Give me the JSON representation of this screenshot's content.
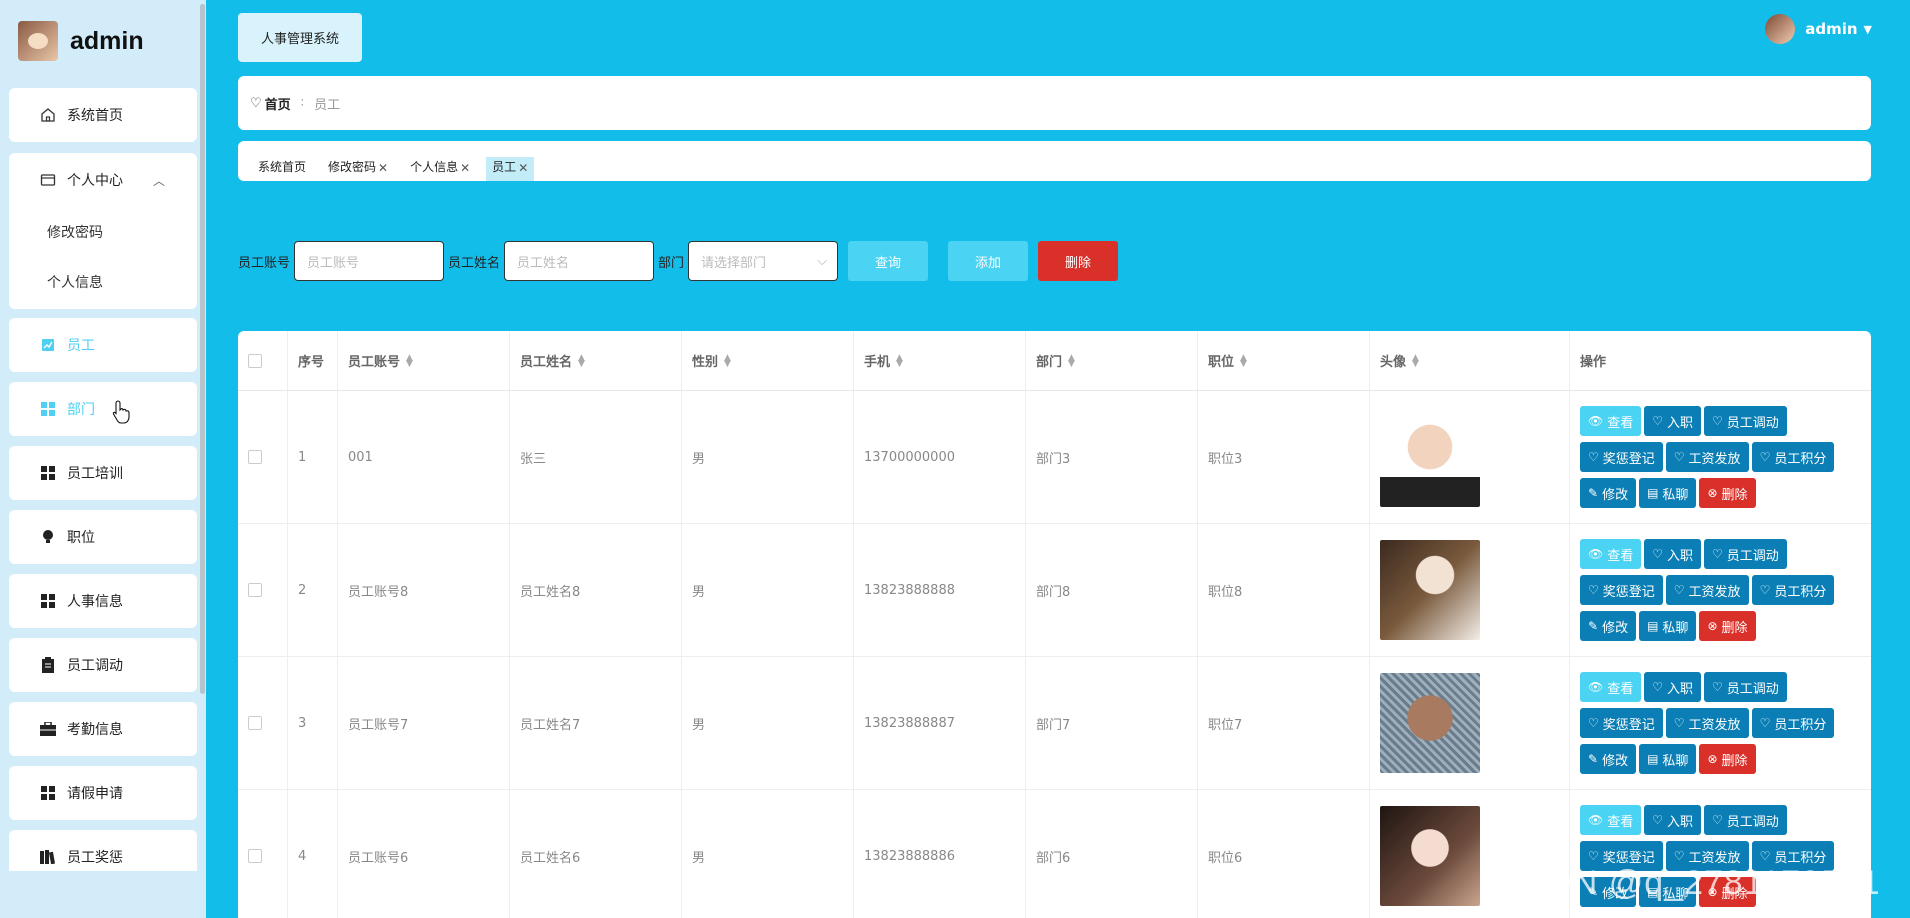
{
  "brand": {
    "name": "admin"
  },
  "sidebar": {
    "items": [
      {
        "label": "系统首页",
        "icon": "home-icon"
      },
      {
        "label": "个人中心",
        "icon": "card-icon"
      },
      {
        "label": "修改密码"
      },
      {
        "label": "个人信息"
      },
      {
        "label": "员工",
        "icon": "chart-icon"
      },
      {
        "label": "部门",
        "icon": "grid-icon"
      },
      {
        "label": "员工培训",
        "icon": "grid-icon"
      },
      {
        "label": "职位",
        "icon": "bulb-icon"
      },
      {
        "label": "人事信息",
        "icon": "grid-icon"
      },
      {
        "label": "员工调动",
        "icon": "clipboard-icon"
      },
      {
        "label": "考勤信息",
        "icon": "briefcase-icon"
      },
      {
        "label": "请假申请",
        "icon": "grid-icon"
      },
      {
        "label": "员工奖惩",
        "icon": "books-icon"
      }
    ]
  },
  "header": {
    "system_tab": "人事管理系统",
    "user": "admin"
  },
  "breadcrumb": {
    "home": "首页",
    "current": "员工"
  },
  "tags": [
    {
      "label": "系统首页",
      "closable": false
    },
    {
      "label": "修改密码",
      "closable": true
    },
    {
      "label": "个人信息",
      "closable": true
    },
    {
      "label": "员工",
      "closable": true,
      "active": true
    }
  ],
  "search": {
    "account_label": "员工账号",
    "account_placeholder": "员工账号",
    "name_label": "员工姓名",
    "name_placeholder": "员工姓名",
    "dept_label": "部门",
    "dept_placeholder": "请选择部门",
    "query_btn": "查询",
    "add_btn": "添加",
    "delete_btn": "删除"
  },
  "table": {
    "headers": [
      "序号",
      "员工账号",
      "员工姓名",
      "性别",
      "手机",
      "部门",
      "职位",
      "头像",
      "操作"
    ],
    "rows": [
      {
        "index": "1",
        "account": "001",
        "name": "张三",
        "gender": "男",
        "phone": "13700000000",
        "dept": "部门3",
        "position": "职位3"
      },
      {
        "index": "2",
        "account": "员工账号8",
        "name": "员工姓名8",
        "gender": "男",
        "phone": "13823888888",
        "dept": "部门8",
        "position": "职位8"
      },
      {
        "index": "3",
        "account": "员工账号7",
        "name": "员工姓名7",
        "gender": "男",
        "phone": "13823888887",
        "dept": "部门7",
        "position": "职位7"
      },
      {
        "index": "4",
        "account": "员工账号6",
        "name": "员工姓名6",
        "gender": "男",
        "phone": "13823888886",
        "dept": "部门6",
        "position": "职位6"
      }
    ],
    "ops": [
      "查看",
      "入职",
      "员工调动",
      "奖惩登记",
      "工资发放",
      "员工积分",
      "修改",
      "私聊",
      "删除"
    ]
  },
  "colors": {
    "background": "#13bde9",
    "op_blue": "#0b7fb5",
    "op_light": "#4ad3f2",
    "danger": "#d9302a"
  },
  "watermark": "CSDN @q_2781179521"
}
